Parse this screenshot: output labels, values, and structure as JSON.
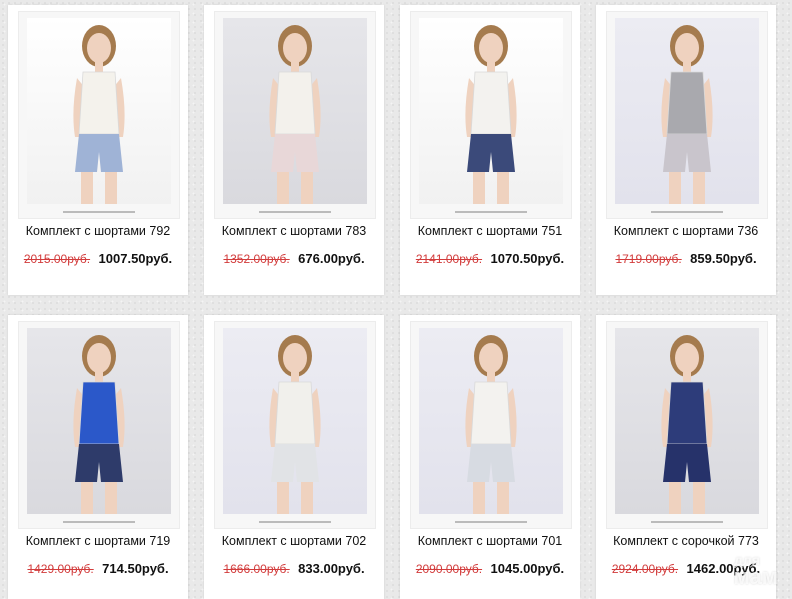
{
  "products": [
    {
      "title": "Комплект с шортами 792",
      "old_price": "2015.00руб.",
      "price": "1007.50руб.",
      "top": "#f4f2ec",
      "bottom": "#9fb3d6",
      "bg": "white"
    },
    {
      "title": "Комплект с шортами 783",
      "old_price": "1352.00руб.",
      "price": "676.00руб.",
      "top": "#f3f1ec",
      "bottom": "#e8d7d8",
      "bg": "grey"
    },
    {
      "title": "Комплект с шортами 751",
      "old_price": "2141.00руб.",
      "price": "1070.50руб.",
      "top": "#f3f2ef",
      "bottom": "#3b4a7a",
      "bg": "white"
    },
    {
      "title": "Комплект с шортами 736",
      "old_price": "1719.00руб.",
      "price": "859.50руб.",
      "top": "#a9a9ae",
      "bottom": "#c9c5cc",
      "bg": "lav"
    },
    {
      "title": "Комплект с шортами 719",
      "old_price": "1429.00руб.",
      "price": "714.50руб.",
      "top": "#2b58c9",
      "bottom": "#2e3b6a",
      "bg": "grey"
    },
    {
      "title": "Комплект с шортами 702",
      "old_price": "1666.00руб.",
      "price": "833.00руб.",
      "top": "#f1f0ec",
      "bottom": "#e1e3e6",
      "bg": "lav"
    },
    {
      "title": "Комплект с шортами 701",
      "old_price": "2090.00руб.",
      "price": "1045.00руб.",
      "top": "#f3f2ef",
      "bottom": "#d7dbe2",
      "bg": "lav"
    },
    {
      "title": "Комплект с сорочкой 773",
      "old_price": "2924.00руб.",
      "price": "1462.00руб.",
      "top": "#2d3c7a",
      "bottom": "#26326a",
      "bg": "grey"
    }
  ],
  "watermark": {
    "line1": "для",
    "line2": "мам"
  }
}
